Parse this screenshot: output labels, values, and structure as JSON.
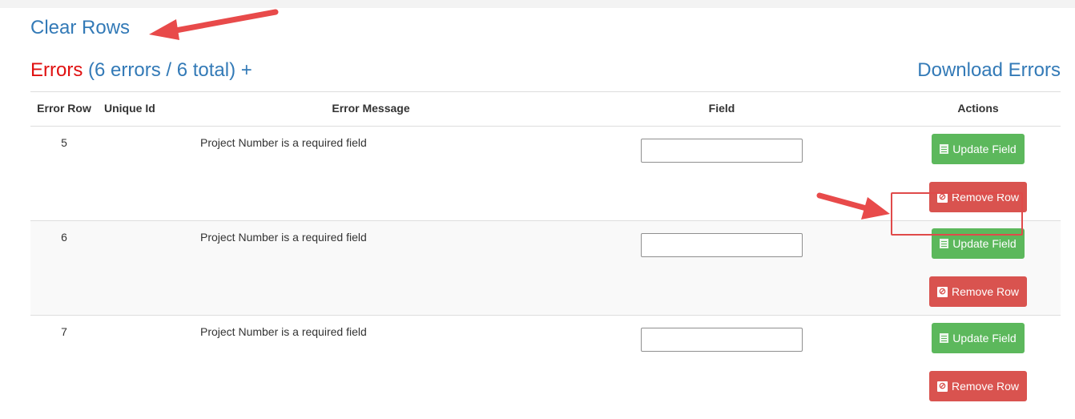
{
  "clear_rows_label": "Clear Rows",
  "errors_header": {
    "label": "Errors",
    "summary": "(6 errors / 6 total) +"
  },
  "download_label": "Download Errors",
  "table": {
    "columns": {
      "error_row": "Error Row",
      "unique_id": "Unique Id",
      "error_message": "Error Message",
      "field": "Field",
      "actions": "Actions"
    },
    "rows": [
      {
        "error_row": "5",
        "unique_id": "",
        "error_message": "Project Number is a required field",
        "field_value": "",
        "update_label": "Update Field",
        "remove_label": "Remove Row"
      },
      {
        "error_row": "6",
        "unique_id": "",
        "error_message": "Project Number is a required field",
        "field_value": "",
        "update_label": "Update Field",
        "remove_label": "Remove Row"
      },
      {
        "error_row": "7",
        "unique_id": "",
        "error_message": "Project Number is a required field",
        "field_value": "",
        "update_label": "Update Field",
        "remove_label": "Remove Row"
      }
    ]
  },
  "icons": {
    "update": "document-icon",
    "remove": "ban-icon"
  },
  "colors": {
    "link": "#337ab7",
    "error_title": "#e01010",
    "update_button": "#5cb85c",
    "remove_button": "#d9534f",
    "annotation": "#e84a4a"
  }
}
